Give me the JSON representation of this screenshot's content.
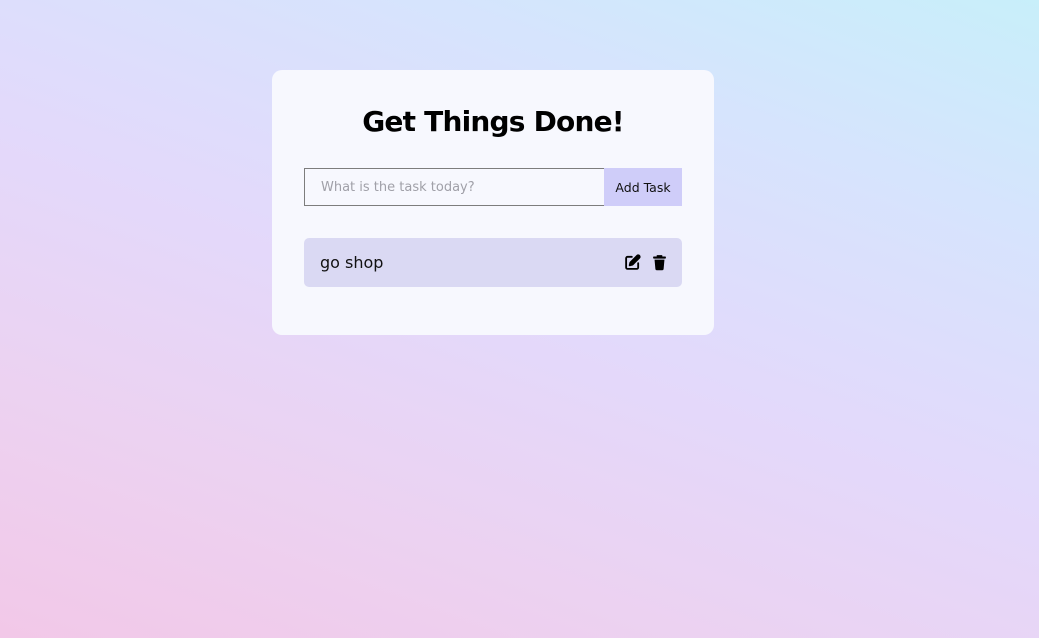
{
  "header": {
    "title": "Get Things Done!"
  },
  "form": {
    "placeholder": "What is the task today?",
    "value": "",
    "add_label": "Add Task"
  },
  "todos": [
    {
      "text": "go shop"
    }
  ],
  "icons": {
    "edit": "edit-icon",
    "delete": "trash-icon"
  },
  "colors": {
    "card_bg": "#f7f8fe",
    "button_bg": "#cfcdf9",
    "todo_bg": "#dad9f3"
  }
}
